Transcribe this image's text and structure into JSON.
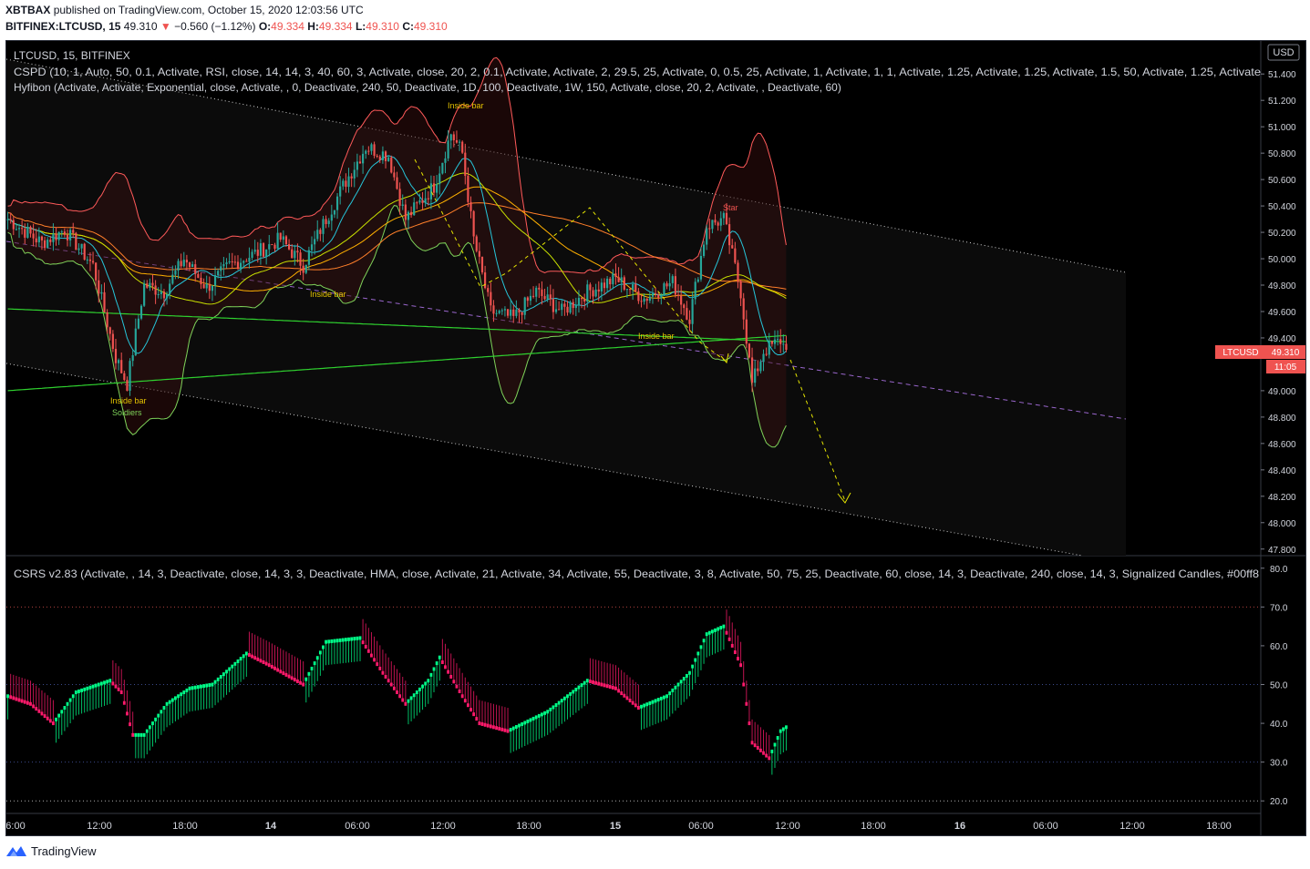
{
  "header": {
    "publisher": "XBTBAX",
    "published_text": "published on TradingView.com, October 15, 2020 12:03:56 UTC",
    "symbol_line": "BITFINEX:LTCUSD, 15",
    "last": "49.310",
    "change": "−0.560 (−1.12%)",
    "o_label": "O:",
    "o": "49.334",
    "h_label": "H:",
    "h": "49.334",
    "l_label": "L:",
    "l": "49.310",
    "c_label": "C:",
    "c": "49.310"
  },
  "legend": {
    "title": "LTCUSD, 15, BITFINEX",
    "ind1": "CSPD (10, 1, Auto, 50, 0.1, Activate, RSI, close, 14, 14, 3, 40, 60, 3, Activate, close, 20, 2, 0.1, Activate, Activate, 2, 29.5, 25, Activate, 0, 0.5, 25, Activate, 1, Activate, 1, 1, Activate, 1.25, Activate, 1.25, Activate, 1.5, 50, Activate, 1.25, Activate",
    "ind2": "Hyfibon (Activate, Activate, Exponential, close, Activate, , 0, Deactivate, 240, 50, Deactivate, 1D, 100, Deactivate, 1W, 150, Activate, close, 20, 2, Activate, , Deactivate, 60)",
    "osc": "CSRS v2.83 (Activate, , 14, 3, Deactivate, close, 14, 3, 3, Deactivate, HMA, close, Activate, 21, Activate, 34, Activate, 55, Deactivate, 3, 8, Activate, 50, 75, 25, Deactivate, 60, close, 14, 3, Deactivate, 240, close, 14, 3, Signalized Candles, #00ff8"
  },
  "price_axis": {
    "currency": "USD",
    "ticks": [
      "51.400",
      "51.200",
      "51.000",
      "50.800",
      "50.600",
      "50.400",
      "50.200",
      "50.000",
      "49.800",
      "49.600",
      "49.400",
      "49.000",
      "48.800",
      "48.600",
      "48.400",
      "48.200",
      "48.000",
      "47.800"
    ],
    "symbol_tag": "LTCUSD",
    "price_tag": "49.310",
    "countdown": "11:05"
  },
  "osc_axis": {
    "ticks": [
      "80.0",
      "70.0",
      "60.0",
      "50.0",
      "40.0",
      "30.0",
      "20.0"
    ]
  },
  "time_axis": {
    "ticks": [
      "6:00",
      "12:00",
      "18:00",
      "14",
      "06:00",
      "12:00",
      "18:00",
      "15",
      "06:00",
      "12:00",
      "18:00",
      "16",
      "06:00",
      "12:00",
      "18:00"
    ]
  },
  "annotations": {
    "inside_bar": "Inside bar",
    "soldiers": "Soldiers",
    "star": "Star"
  },
  "colors": {
    "up": "#26a69a",
    "down": "#ef5350",
    "bg": "#000000",
    "osc_up": "#00ff88",
    "osc_down": "#ff1a6b",
    "upper_band": "#ff5a5a",
    "lower_band": "#7fd35a",
    "ema_long": "#2fd12f",
    "ema_mid": "#ffb000",
    "ema_short": "#26c6da",
    "projection": "#e6e600",
    "regression": "#9966cc"
  },
  "chart_data": {
    "type": "candlestick",
    "title": "LTCUSD, 15, BITFINEX",
    "y_range": [
      47.75,
      51.65
    ],
    "osc_range": [
      17,
      83
    ],
    "x_span_bars": 275,
    "key_prices": {
      "high": 51.12,
      "low": 48.98,
      "last": 49.31
    },
    "osc_levels": [
      70,
      50,
      30
    ],
    "legend": "none"
  },
  "footer": {
    "brand": "TradingView"
  }
}
